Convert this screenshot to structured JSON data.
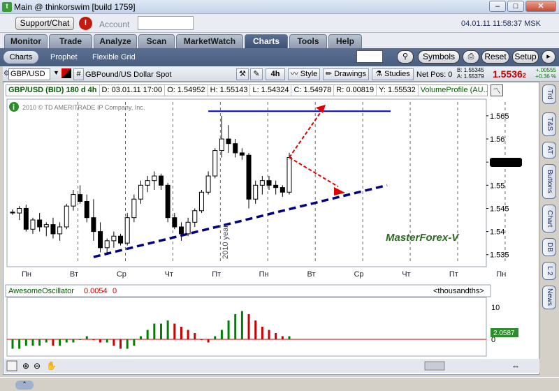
{
  "window": {
    "title": "Main @ thinkorswim [build 1759]",
    "icon": "thinkorswim-icon"
  },
  "toolbar": {
    "support_label": "Support/Chat",
    "alert_label": "!",
    "account_label": "Account",
    "datetime": "04.01.11 11:58:37 MSK"
  },
  "tabs": [
    {
      "label": "Monitor"
    },
    {
      "label": "Trade"
    },
    {
      "label": "Analyze"
    },
    {
      "label": "Scan"
    },
    {
      "label": "MarketWatch"
    },
    {
      "label": "Charts",
      "active": true
    },
    {
      "label": "Tools"
    },
    {
      "label": "Help"
    }
  ],
  "subtabs": {
    "charts": "Charts",
    "prophet": "Prophet",
    "flexible_grid": "Flexible Grid",
    "symbols": "Symbols",
    "reset": "Reset",
    "setup": "Setup"
  },
  "chartbar": {
    "symbol": "GBP/USD",
    "description": "GBPound/US Dollar Spot",
    "aggregation": "4h",
    "style": "Style",
    "drawings": "Drawings",
    "studies": "Studies",
    "netpos": "Net Pos: 0",
    "bid": "B: 1.55345",
    "ask": "A: 1.55379",
    "last": "1.5536",
    "last_suffix": "2",
    "change": "+.00555",
    "change_pct": "+0.36 %"
  },
  "infobar": {
    "symbol": "GBP/USD (BID) 180 d 4h",
    "date": "D: 03.01.11 17:00",
    "open": "O: 1.54952",
    "high": "H: 1.55143",
    "low": "L: 1.54324",
    "close": "C: 1.54978",
    "range": "R: 0.00819",
    "y": "Y: 1.55532",
    "study": "VolumeProfile (AU..."
  },
  "copyright": "2010 © TD AMERITRADE IP Company, Inc.",
  "watermark": "MasterForex-V",
  "year_label": "2010 year",
  "oscillator": {
    "name": "AwesomeOscillator",
    "value": "0.0054",
    "value2": "0",
    "units": "<thousandths>",
    "top_tick": "10",
    "zero_tick": "0",
    "readout": "2.0587"
  },
  "sidetabs": [
    "Trd",
    "T&S",
    "AT",
    "Buttons",
    "Chart",
    "DB",
    "L 2",
    "News"
  ],
  "colors": {
    "up": "#ffffff",
    "down": "#000000",
    "osc_up": "#008000",
    "osc_down": "#cc0000",
    "resistance": "#0000cc",
    "support": "#000080",
    "arrow": "#e00000",
    "watermark": "#2d6a22"
  },
  "chart_data": {
    "type": "candlestick",
    "price_ticks": [
      "1.565",
      "1.56",
      "1.555",
      "1.55",
      "1.545",
      "1.54",
      "1.535"
    ],
    "price_range": [
      1.533,
      1.568
    ],
    "day_labels": [
      "Пн",
      "Вт",
      "Ср",
      "Чт",
      "Пт",
      "Пн",
      "Вт",
      "Ср",
      "Чт",
      "Пт",
      "Пн"
    ],
    "candles": [
      [
        1.5442,
        1.5448,
        1.5436,
        1.544
      ],
      [
        1.544,
        1.5455,
        1.5425,
        1.545
      ],
      [
        1.545,
        1.5458,
        1.54,
        1.5405
      ],
      [
        1.5405,
        1.543,
        1.5395,
        1.5425
      ],
      [
        1.5425,
        1.544,
        1.54,
        1.541
      ],
      [
        1.541,
        1.542,
        1.539,
        1.5415
      ],
      [
        1.5415,
        1.543,
        1.5385,
        1.5395
      ],
      [
        1.5395,
        1.542,
        1.538,
        1.541
      ],
      [
        1.541,
        1.546,
        1.5405,
        1.5455
      ],
      [
        1.5455,
        1.549,
        1.5445,
        1.548
      ],
      [
        1.548,
        1.55,
        1.546,
        1.5465
      ],
      [
        1.5465,
        1.548,
        1.542,
        1.543
      ],
      [
        1.543,
        1.547,
        1.538,
        1.54
      ],
      [
        1.54,
        1.542,
        1.5355,
        1.5365
      ],
      [
        1.5365,
        1.5385,
        1.535,
        1.538
      ],
      [
        1.538,
        1.54,
        1.5365,
        1.539
      ],
      [
        1.539,
        1.5395,
        1.537,
        1.5375
      ],
      [
        1.5375,
        1.544,
        1.537,
        1.543
      ],
      [
        1.543,
        1.548,
        1.542,
        1.547
      ],
      [
        1.547,
        1.551,
        1.546,
        1.55
      ],
      [
        1.55,
        1.552,
        1.5485,
        1.551
      ],
      [
        1.551,
        1.553,
        1.549,
        1.552
      ],
      [
        1.552,
        1.5525,
        1.549,
        1.55
      ],
      [
        1.55,
        1.5505,
        1.542,
        1.543
      ],
      [
        1.543,
        1.544,
        1.5405,
        1.541
      ],
      [
        1.541,
        1.542,
        1.538,
        1.5395
      ],
      [
        1.5395,
        1.543,
        1.539,
        1.542
      ],
      [
        1.542,
        1.545,
        1.541,
        1.5445
      ],
      [
        1.5445,
        1.549,
        1.544,
        1.5485
      ],
      [
        1.5485,
        1.553,
        1.548,
        1.552
      ],
      [
        1.552,
        1.558,
        1.5515,
        1.5575
      ],
      [
        1.5575,
        1.565,
        1.556,
        1.56
      ],
      [
        1.56,
        1.563,
        1.557,
        1.559
      ],
      [
        1.559,
        1.56,
        1.556,
        1.557
      ],
      [
        1.557,
        1.558,
        1.5555,
        1.5565
      ],
      [
        1.5565,
        1.557,
        1.545,
        1.547
      ],
      [
        1.547,
        1.551,
        1.546,
        1.55
      ],
      [
        1.55,
        1.552,
        1.548,
        1.551
      ],
      [
        1.551,
        1.552,
        1.549,
        1.55
      ],
      [
        1.55,
        1.551,
        1.548,
        1.5495
      ],
      [
        1.5495,
        1.55,
        1.5475,
        1.5485
      ],
      [
        1.5485,
        1.557,
        1.548,
        1.556
      ]
    ],
    "oscillator_bars": [
      -3,
      -3,
      -2,
      -2,
      -2,
      -1,
      -2,
      -2,
      -1,
      -1,
      0,
      1,
      0,
      -1,
      -1,
      -2,
      -3,
      -3,
      -2,
      1,
      3,
      5,
      5,
      6,
      5,
      4,
      3,
      2,
      0,
      -1,
      1,
      3,
      6,
      8,
      9,
      8,
      6,
      4,
      3,
      2,
      1,
      1
    ],
    "resistance_line": {
      "from_price": 1.566,
      "to_price": 1.566
    },
    "support_line": {
      "from_price": 1.5345,
      "to_price": 1.55
    }
  }
}
